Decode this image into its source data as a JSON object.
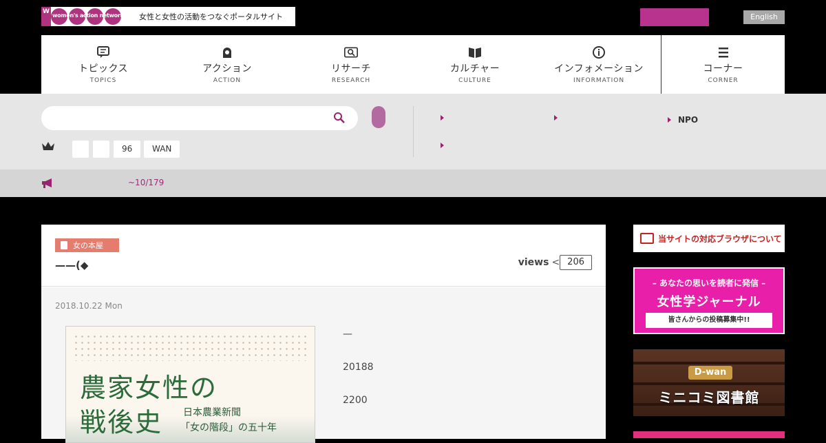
{
  "header": {
    "logo_text": "women's action network",
    "tagline": "女性と女性の活動をつなぐポータルサイト",
    "lang_button": "English"
  },
  "nav": {
    "items": [
      {
        "jp": "トピックス",
        "en": "TOPICS",
        "icon": "chat-icon"
      },
      {
        "jp": "アクション",
        "en": "ACTION",
        "icon": "person-icon"
      },
      {
        "jp": "リサーチ",
        "en": "RESEARCH",
        "icon": "magnifier-icon"
      },
      {
        "jp": "カルチャー",
        "en": "CULTURE",
        "icon": "book-icon"
      },
      {
        "jp": "インフォメーション",
        "en": "INFORMATION",
        "icon": "info-icon"
      },
      {
        "jp": "コーナー",
        "en": "CORNER",
        "icon": "menu-icon"
      }
    ]
  },
  "search": {
    "placeholder": "",
    "tags": [
      "",
      "",
      "96",
      "WAN"
    ],
    "links": [
      "",
      "",
      "NPO",
      ""
    ]
  },
  "news": {
    "text": "~10/179"
  },
  "article": {
    "category": "女の本屋",
    "title": "——(◆",
    "views_label": "views",
    "views_arrow": "<",
    "views_count": "206",
    "date": "2018.10.22 Mon",
    "cover": {
      "title_line1": "農家女性の",
      "title_line2": "戦後史",
      "sub1": "日本農業新聞",
      "sub2": "「女の階段」の五十年"
    },
    "body_lines": [
      "—",
      "20188",
      "2200"
    ]
  },
  "sidebar": {
    "browser_link": "当サイトの対応ブラウザについて",
    "banner1": {
      "line1": "– あなたの思いを読者に発信 –",
      "line2": "女性学ジャーナル",
      "ribbon": "皆さんからの投稿募集中!!"
    },
    "banner2": {
      "tag": "D-wan",
      "title": "ミニコミ図書館"
    }
  },
  "colors": {
    "brand": "#b0337f",
    "accent_pink": "#e81fa8",
    "category": "#e57d6e",
    "news_text": "#9b2b7b"
  }
}
